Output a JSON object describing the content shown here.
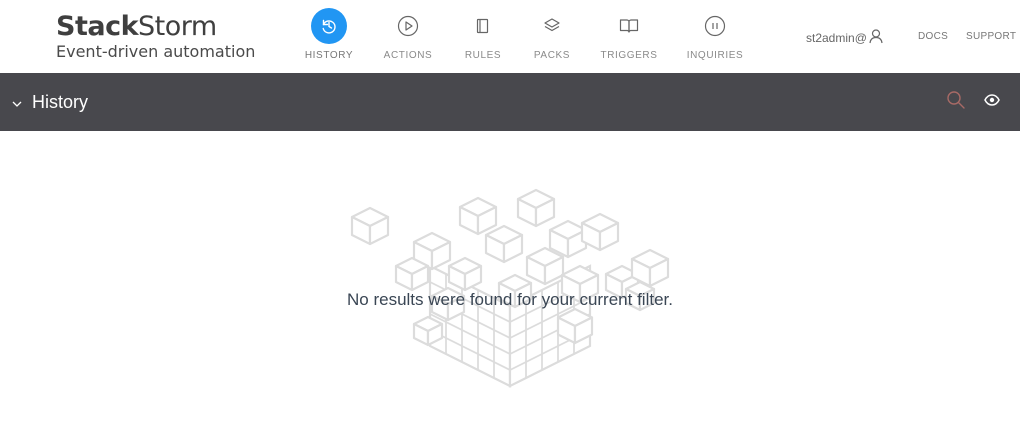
{
  "brand": {
    "name_bold": "Stack",
    "name_rest": "Storm",
    "tagline": "Event-driven automation"
  },
  "nav": [
    {
      "label": "HISTORY",
      "icon": "history-icon",
      "active": true
    },
    {
      "label": "ACTIONS",
      "icon": "play-icon",
      "active": false
    },
    {
      "label": "RULES",
      "icon": "rules-icon",
      "active": false
    },
    {
      "label": "PACKS",
      "icon": "layers-icon",
      "active": false
    },
    {
      "label": "TRIGGERS",
      "icon": "book-icon",
      "active": false
    },
    {
      "label": "INQUIRIES",
      "icon": "pause-icon",
      "active": false
    }
  ],
  "user": {
    "name": "st2admin@",
    "icon": "user-icon"
  },
  "links": {
    "docs": "DOCS",
    "support": "SUPPORT"
  },
  "header": {
    "title": "History",
    "toggle_icon": "chevron-down-icon",
    "search_icon": "search-icon",
    "watch_icon": "eye-icon"
  },
  "empty_state": {
    "message": "No results were found for your current filter.",
    "illustration_icon": "cubes-illustration"
  },
  "colors": {
    "accent": "#2196f3",
    "header_bg": "#48484d",
    "search_icon": "#a86a66"
  }
}
